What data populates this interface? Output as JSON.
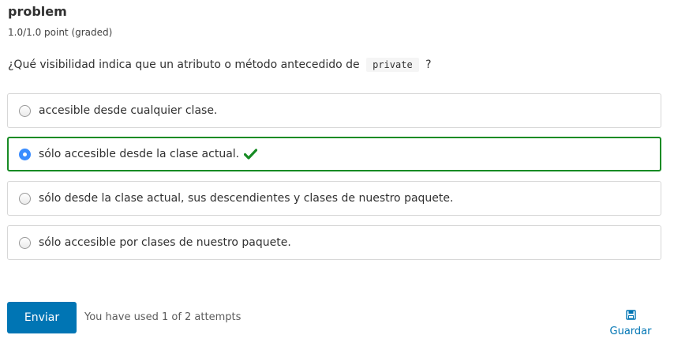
{
  "problem": {
    "title": "problem",
    "points": "1.0/1.0 point (graded)",
    "question_before": "¿Qué visibilidad indica que un atributo o método antecedido de",
    "question_code": "private",
    "question_after": "?"
  },
  "options": [
    {
      "label": "accesible desde cualquier clase.",
      "selected": false,
      "correct": false
    },
    {
      "label": "sólo accesible desde la clase actual.",
      "selected": true,
      "correct": true
    },
    {
      "label": "sólo desde la clase actual, sus descendientes y clases de nuestro paquete.",
      "selected": false,
      "correct": false
    },
    {
      "label": "sólo accesible por clases de nuestro paquete.",
      "selected": false,
      "correct": false
    }
  ],
  "actions": {
    "submit_label": "Enviar",
    "attempts_text": "You have used 1 of 2 attempts",
    "save_label": "Guardar",
    "save_icon": "save-icon"
  },
  "colors": {
    "accent": "#0075b4",
    "correct": "#178b24",
    "radio_selected": "#3a8dff"
  }
}
